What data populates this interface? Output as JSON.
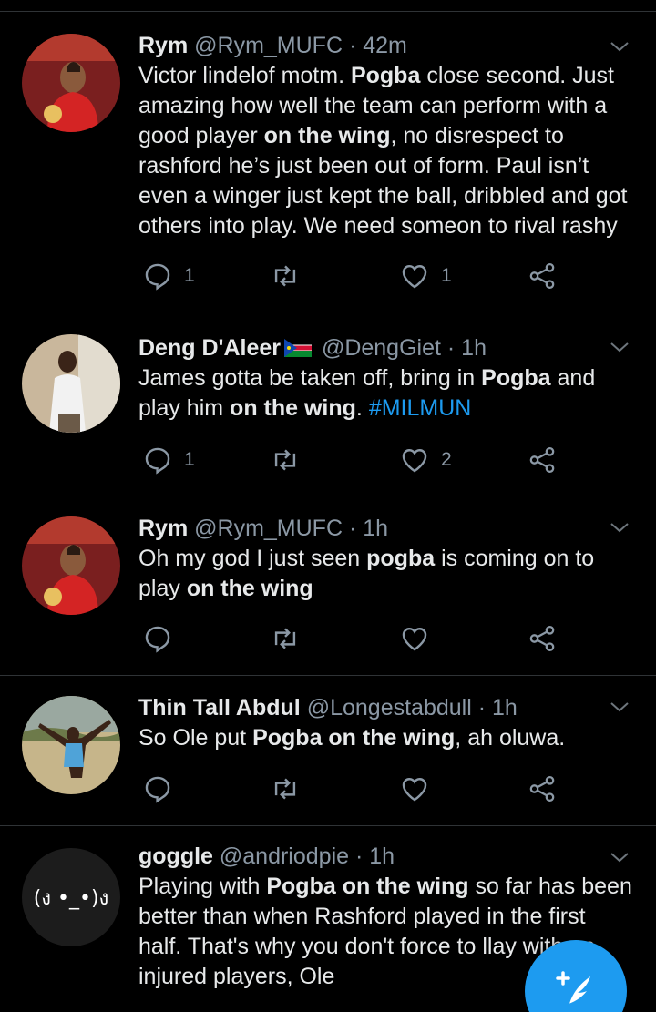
{
  "colors": {
    "background": "#000000",
    "accent": "#1d9bf0",
    "divider": "#2f3336",
    "muted": "#8b98a5",
    "text": "#e7e9ea"
  },
  "tweets": [
    {
      "name": "Rym",
      "handle": "@Rym_MUFC",
      "time": "· 42m",
      "segments": [
        {
          "t": "Victor lindelof motm. ",
          "b": false
        },
        {
          "t": "Pogba",
          "b": true
        },
        {
          "t": " close second. Just amazing how well the team can perform with a good player ",
          "b": false
        },
        {
          "t": "on the wing",
          "b": true
        },
        {
          "t": ", no disrespect to rashford he’s just been out of form. Paul isn’t even a winger just kept the ball, dribbled and got others into play. We need someon to rival rashy",
          "b": false
        }
      ],
      "replies": "1",
      "retweets": "",
      "likes": "1"
    },
    {
      "name": "Deng  D'Aleer",
      "handle": "@DengGiet",
      "time": "· 1h",
      "segments": [
        {
          "t": "James gotta be taken off, bring in ",
          "b": false
        },
        {
          "t": "Pogba",
          "b": true
        },
        {
          "t": " and play him ",
          "b": false
        },
        {
          "t": "on the wing",
          "b": true
        },
        {
          "t": ". ",
          "b": false
        },
        {
          "t": "#MILMUN",
          "b": false,
          "tag": true
        }
      ],
      "replies": "1",
      "retweets": "",
      "likes": "2"
    },
    {
      "name": "Rym",
      "handle": "@Rym_MUFC",
      "time": "· 1h",
      "segments": [
        {
          "t": "Oh my god I just seen ",
          "b": false
        },
        {
          "t": "pogba",
          "b": true
        },
        {
          "t": " is coming on to play ",
          "b": false
        },
        {
          "t": "on the wing",
          "b": true
        }
      ],
      "replies": "",
      "retweets": "",
      "likes": ""
    },
    {
      "name": "Thin Tall Abdul",
      "handle": "@Longestabdull",
      "time": "· 1h",
      "segments": [
        {
          "t": "So Ole put ",
          "b": false
        },
        {
          "t": "Pogba on the wing",
          "b": true
        },
        {
          "t": ", ah oluwa.",
          "b": false
        }
      ],
      "replies": "",
      "retweets": "",
      "likes": ""
    },
    {
      "name": "goggle",
      "handle": "@andriodpie",
      "time": "· 1h",
      "avatar_text": "(ง •_•)ง",
      "segments": [
        {
          "t": "Playing with ",
          "b": false
        },
        {
          "t": "Pogba on the wing",
          "b": true
        },
        {
          "t": " so far has been better than when Rashford played in the first half. That's why you don't force to llay with an injured players, Ole",
          "b": false
        }
      ],
      "replies": "",
      "retweets": "",
      "likes": ""
    }
  ],
  "icons": {
    "reply": "reply-icon",
    "retweet": "retweet-icon",
    "like": "like-icon",
    "share": "share-icon",
    "more": "chevron-down-icon",
    "compose": "compose-tweet-icon"
  }
}
